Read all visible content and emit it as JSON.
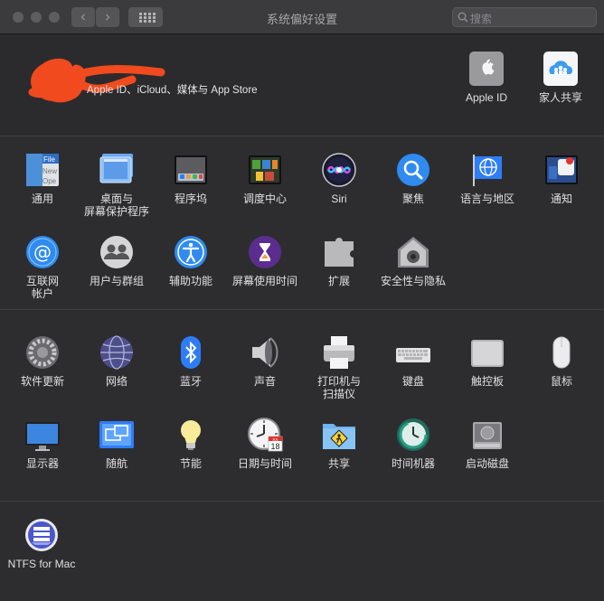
{
  "window": {
    "title": "系统偏好设置"
  },
  "search": {
    "placeholder": "搜索"
  },
  "account": {
    "text": "Apple ID、iCloud、媒体与 App Store"
  },
  "top_panes": [
    {
      "label": "Apple ID",
      "icon": "apple-logo-icon"
    },
    {
      "label": "家人共享",
      "icon": "family-sharing-icon"
    }
  ],
  "row1": [
    {
      "label": "通用",
      "icon": "general-icon"
    },
    {
      "label": "桌面与\n屏幕保护程序",
      "icon": "desktop-screensaver-icon"
    },
    {
      "label": "程序坞",
      "icon": "dock-icon"
    },
    {
      "label": "调度中心",
      "icon": "mission-control-icon"
    },
    {
      "label": "Siri",
      "icon": "siri-icon"
    },
    {
      "label": "聚焦",
      "icon": "spotlight-icon"
    },
    {
      "label": "语言与地区",
      "icon": "language-region-icon"
    },
    {
      "label": "通知",
      "icon": "notifications-icon"
    }
  ],
  "row2": [
    {
      "label": "互联网\n帐户",
      "icon": "internet-accounts-icon"
    },
    {
      "label": "用户与群组",
      "icon": "users-groups-icon"
    },
    {
      "label": "辅助功能",
      "icon": "accessibility-icon"
    },
    {
      "label": "屏幕使用时间",
      "icon": "screen-time-icon"
    },
    {
      "label": "扩展",
      "icon": "extensions-icon"
    },
    {
      "label": "安全性与隐私",
      "icon": "security-privacy-icon"
    }
  ],
  "row3": [
    {
      "label": "软件更新",
      "icon": "software-update-icon"
    },
    {
      "label": "网络",
      "icon": "network-icon"
    },
    {
      "label": "蓝牙",
      "icon": "bluetooth-icon"
    },
    {
      "label": "声音",
      "icon": "sound-icon"
    },
    {
      "label": "打印机与\n扫描仪",
      "icon": "printer-scanner-icon"
    },
    {
      "label": "键盘",
      "icon": "keyboard-icon"
    },
    {
      "label": "触控板",
      "icon": "trackpad-icon"
    },
    {
      "label": "鼠标",
      "icon": "mouse-icon"
    }
  ],
  "row4": [
    {
      "label": "显示器",
      "icon": "displays-icon"
    },
    {
      "label": "随航",
      "icon": "sidecar-icon"
    },
    {
      "label": "节能",
      "icon": "energy-saver-icon"
    },
    {
      "label": "日期与时间",
      "icon": "date-time-icon"
    },
    {
      "label": "共享",
      "icon": "sharing-icon"
    },
    {
      "label": "时间机器",
      "icon": "time-machine-icon"
    },
    {
      "label": "启动磁盘",
      "icon": "startup-disk-icon"
    }
  ],
  "row5": [
    {
      "label": "NTFS for Mac",
      "icon": "ntfs-for-mac-icon"
    }
  ],
  "date_icon": {
    "month": "JUL",
    "day": "18"
  },
  "general_icon": {
    "file": "File",
    "new": "New",
    "open": "Ope"
  },
  "colors": {
    "window_bg": "#2a2a2c",
    "titlebar": "#3b3b3d",
    "scribble": "#f04a1e",
    "accent_blue": "#2f7df6"
  }
}
